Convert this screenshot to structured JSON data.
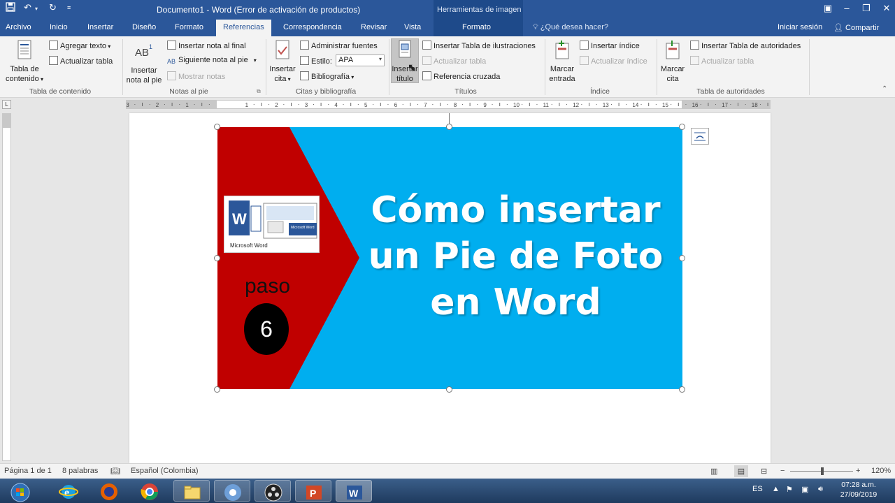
{
  "title_bar": {
    "window_title": "Documento1 - Word (Error de activación de productos)",
    "context_group": "Herramientas de imagen"
  },
  "tabs": [
    "Archivo",
    "Inicio",
    "Insertar",
    "Diseño",
    "Formato",
    "Referencias",
    "Correspondencia",
    "Revisar",
    "Vista"
  ],
  "active_tab": "Referencias",
  "context_tab": "Formato",
  "search_placeholder": "¿Qué desea hacer?",
  "signin": "Iniciar sesión",
  "share": "Compartir",
  "ribbon": {
    "toc": {
      "big_button": [
        "Tabla de",
        "contenido"
      ],
      "add_text": "Agregar texto",
      "update_table": "Actualizar tabla",
      "label": "Tabla de contenido"
    },
    "footnotes": {
      "big_button": [
        "Insertar",
        "nota al pie"
      ],
      "insert_endnote": "Insertar nota al final",
      "next_footnote": "Siguiente nota al pie",
      "show_notes": "Mostrar notas",
      "label": "Notas al pie"
    },
    "citations": {
      "big_button": [
        "Insertar",
        "cita"
      ],
      "manage_sources": "Administrar fuentes",
      "style_label": "Estilo:",
      "style_value": "APA",
      "bibliography": "Bibliografía",
      "label": "Citas y bibliografía"
    },
    "captions": {
      "big_button": [
        "Insertar",
        "título"
      ],
      "insert_table_figures": "Insertar Tabla de ilustraciones",
      "update_table": "Actualizar tabla",
      "cross_reference": "Referencia cruzada",
      "label": "Títulos"
    },
    "index": {
      "big_button": [
        "Marcar",
        "entrada"
      ],
      "insert_index": "Insertar índice",
      "update_index": "Actualizar índice",
      "label": "Índice"
    },
    "authorities": {
      "big_button": [
        "Marcar",
        "cita"
      ],
      "insert_table": "Insertar Tabla de autoridades",
      "update_table": "Actualizar tabla",
      "label": "Tabla de autoridades"
    }
  },
  "ruler_numbers": [
    "3",
    "2",
    "1",
    "1",
    "2",
    "3",
    "4",
    "5",
    "6",
    "7",
    "8",
    "9",
    "10",
    "11",
    "12",
    "13",
    "14",
    "15",
    "16",
    "17",
    "18"
  ],
  "image": {
    "headline": [
      "Cómo insertar",
      "un Pie de Foto",
      "en Word"
    ],
    "thumb_caption": "Microsoft Word",
    "thumb_badge": "Microsoft Word",
    "paso_label": "paso",
    "step_number": "6",
    "colors": {
      "background": "#00aeef",
      "arrow": "#c00000"
    }
  },
  "status_bar": {
    "page": "Página 1 de 1",
    "words": "8 palabras",
    "language": "Español (Colombia)",
    "zoom": "120%"
  },
  "taskbar": {
    "apps": [
      "start-orb",
      "internet-explorer",
      "firefox",
      "chrome",
      "file-explorer",
      "chrome-canary",
      "obs",
      "powerpoint",
      "word"
    ],
    "lang": "ES",
    "time": "07:28 a.m.",
    "date": "27/09/2019"
  }
}
